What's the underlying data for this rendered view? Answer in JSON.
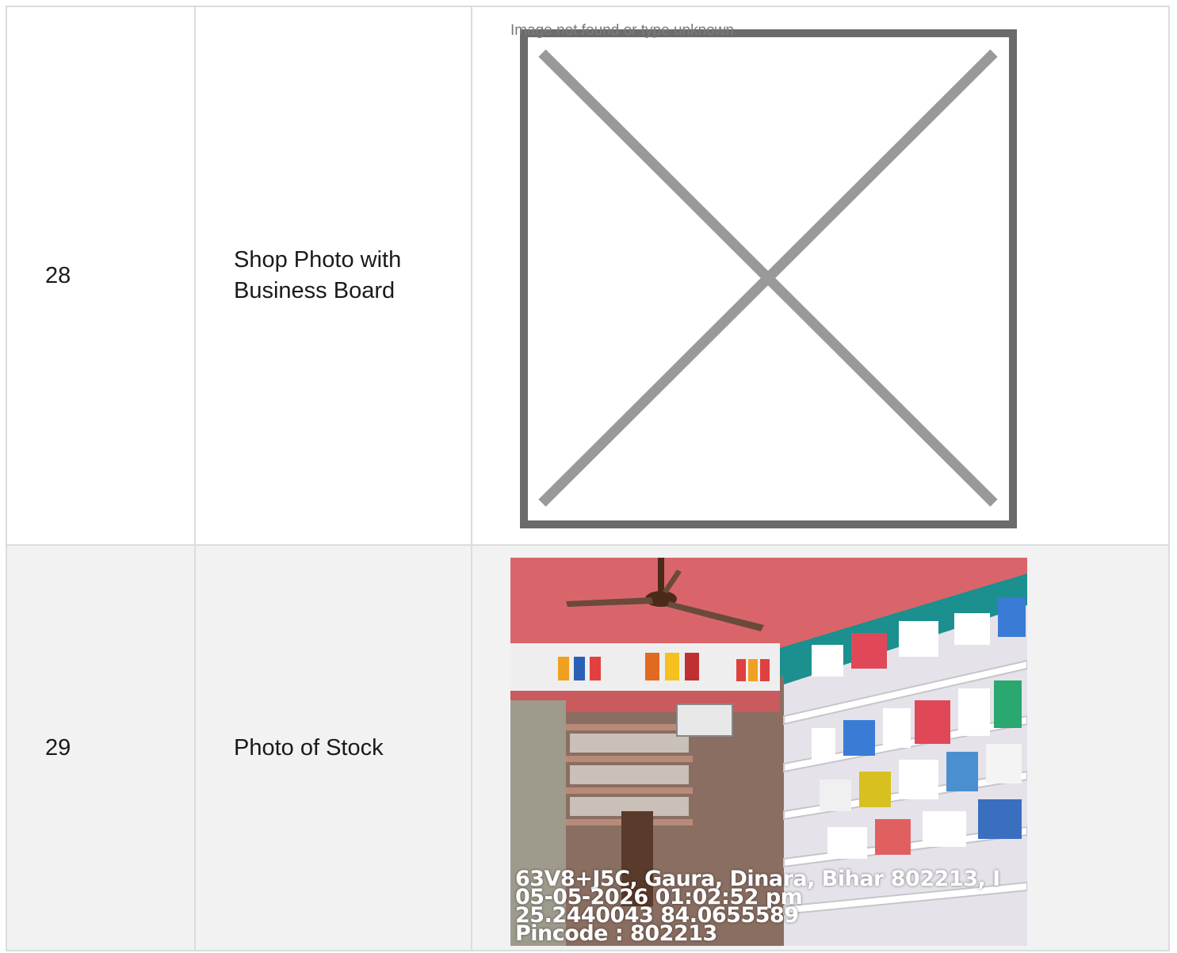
{
  "rows": [
    {
      "number": "28",
      "label": "Shop Photo with Business Board",
      "image": {
        "state": "broken",
        "alt_text": "Image not found or type unknown"
      }
    },
    {
      "number": "29",
      "label": "Photo of Stock",
      "image": {
        "state": "photo",
        "description": "Pharmacy interior with shelves of medicine boxes and a ceiling fan",
        "stamp_lines": [
          "63V8+J5C, Gaura, Dinara, Bihar 802213, I",
          "05-05-2026 01:02:52 pm",
          "25.2440043 84.0655589",
          "Pincode : 802213"
        ]
      }
    }
  ],
  "colors": {
    "border": "#dcdcdc",
    "alt_row_background": "#f2f2f2",
    "broken_frame": "#6b6b6b",
    "broken_cross": "#999999"
  }
}
